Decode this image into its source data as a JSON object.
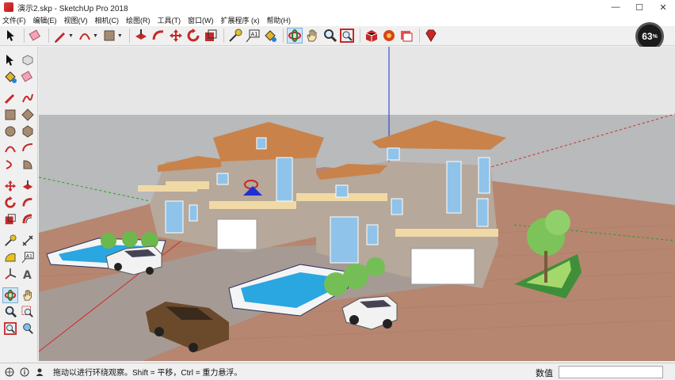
{
  "window": {
    "title": "演示2.skp - SketchUp Pro 2018",
    "minimize_glyph": "—",
    "maximize_glyph": "☐",
    "close_glyph": "✕"
  },
  "menu": {
    "items": [
      "文件(F)",
      "编辑(E)",
      "视图(V)",
      "相机(C)",
      "绘图(R)",
      "工具(T)",
      "窗口(W)",
      "扩展程序 (x)",
      "帮助(H)"
    ]
  },
  "toolbar": {
    "icons": [
      "select-icon",
      "eraser-icon",
      "pencil-icon",
      "arc-icon",
      "paint-bucket-icon",
      "push-pull-icon",
      "follow-me-icon",
      "move-icon",
      "rotate-icon",
      "scale-icon",
      "tape-measure-icon",
      "text-icon",
      "paint-icon",
      "orbit-icon",
      "pan-icon",
      "zoom-icon",
      "zoom-extents-icon",
      "warehouse-icon",
      "extension-warehouse-icon",
      "layout-icon",
      "ruby-icon"
    ]
  },
  "zoom": {
    "value": "63",
    "unit": "%"
  },
  "status": {
    "hint": "拖动以进行环绕观察。Shift = 平移，Ctrl = 重力悬浮。",
    "measurements_label": "数值",
    "measurements_value": ""
  },
  "colors": {
    "sky": "#e7e7e7",
    "ground": "#b7b9bb",
    "paving": "#b88770",
    "roof": "#c9824a",
    "wall": "#b6a89a",
    "pool": "#2aa6e0",
    "axis_blue": "#1f2fd6",
    "axis_red": "#d22a2a",
    "axis_green": "#2a9d2a"
  }
}
